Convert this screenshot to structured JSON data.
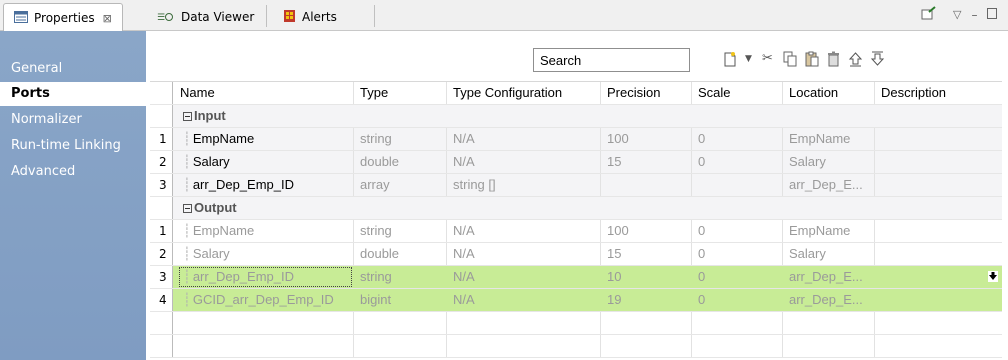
{
  "tabs": [
    {
      "label": "Properties",
      "active": true,
      "icon": "properties-icon",
      "close": "⊠"
    },
    {
      "label": "Data Viewer",
      "active": false,
      "icon": "data-viewer-icon"
    },
    {
      "label": "Alerts",
      "active": false,
      "icon": "alerts-icon"
    }
  ],
  "nav": [
    {
      "label": "General",
      "selected": false
    },
    {
      "label": "Ports",
      "selected": true
    },
    {
      "label": "Normalizer",
      "selected": false
    },
    {
      "label": "Run-time Linking",
      "selected": false
    },
    {
      "label": "Advanced",
      "selected": false
    }
  ],
  "search": {
    "value": "Search"
  },
  "toolbar_icons": [
    "new-port-icon",
    "dropdown-arrow-icon",
    "cut-icon",
    "copy-icon",
    "paste-icon",
    "delete-icon",
    "move-up-icon",
    "move-down-icon"
  ],
  "columns": [
    "Name",
    "Type",
    "Type Configuration",
    "Precision",
    "Scale",
    "Location",
    "Description"
  ],
  "groups": {
    "input": "Input",
    "output": "Output"
  },
  "input_rows": [
    {
      "num": "1",
      "name": "EmpName",
      "type": "string",
      "config": "N/A",
      "precision": "100",
      "scale": "0",
      "location": "EmpName"
    },
    {
      "num": "2",
      "name": "Salary",
      "type": "double",
      "config": "N/A",
      "precision": "15",
      "scale": "0",
      "location": "Salary"
    },
    {
      "num": "3",
      "name": "arr_Dep_Emp_ID",
      "type": "array",
      "config": "string []",
      "precision": "",
      "scale": "",
      "location": "arr_Dep_E..."
    }
  ],
  "output_rows": [
    {
      "num": "1",
      "name": "EmpName",
      "type": "string",
      "config": "N/A",
      "precision": "100",
      "scale": "0",
      "location": "EmpName"
    },
    {
      "num": "2",
      "name": "Salary",
      "type": "double",
      "config": "N/A",
      "precision": "15",
      "scale": "0",
      "location": "Salary"
    },
    {
      "num": "3",
      "name": "arr_Dep_Emp_ID",
      "type": "string",
      "config": "N/A",
      "precision": "10",
      "scale": "0",
      "location": "arr_Dep_E..."
    },
    {
      "num": "4",
      "name": "GCID_arr_Dep_Emp_ID",
      "type": "bigint",
      "config": "N/A",
      "precision": "19",
      "scale": "0",
      "location": "arr_Dep_E..."
    }
  ],
  "colors": {
    "nav_bg": "#7f9cc2",
    "highlight": "#c8ec96"
  }
}
